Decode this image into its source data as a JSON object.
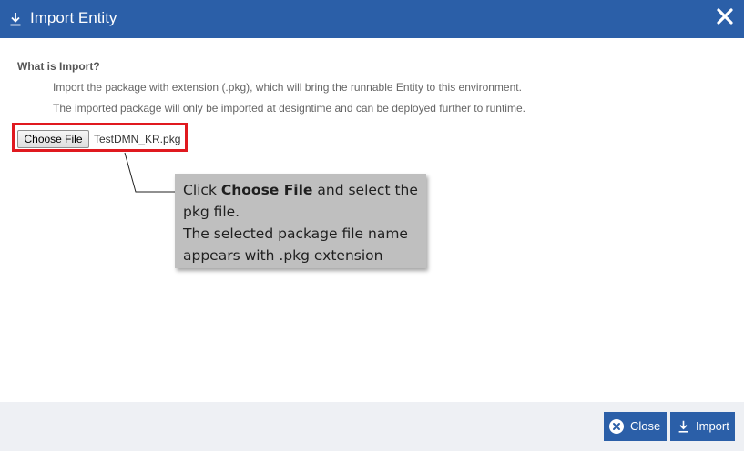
{
  "dialog": {
    "title": "Import Entity"
  },
  "info": {
    "heading": "What is Import?",
    "lines": [
      "Import the package with extension (.pkg), which will bring the runnable Entity to this environment.",
      "The imported package will only be imported at designtime and can be deployed further to runtime."
    ]
  },
  "file_input": {
    "button_label": "Choose File",
    "selected_file": "TestDMN_KR.pkg"
  },
  "callout": {
    "prefix": "Click ",
    "bold": "Choose File",
    "suffix": " and select the pkg file.",
    "line2": "The selected package file name appears with .pkg extension"
  },
  "footer": {
    "close_label": "Close",
    "import_label": "Import"
  },
  "colors": {
    "header": "#2b5fa8",
    "highlight": "#e0191f",
    "callout_bg": "#bfbfbf"
  },
  "icons": [
    "download-icon",
    "close-icon",
    "close-circle-icon"
  ]
}
